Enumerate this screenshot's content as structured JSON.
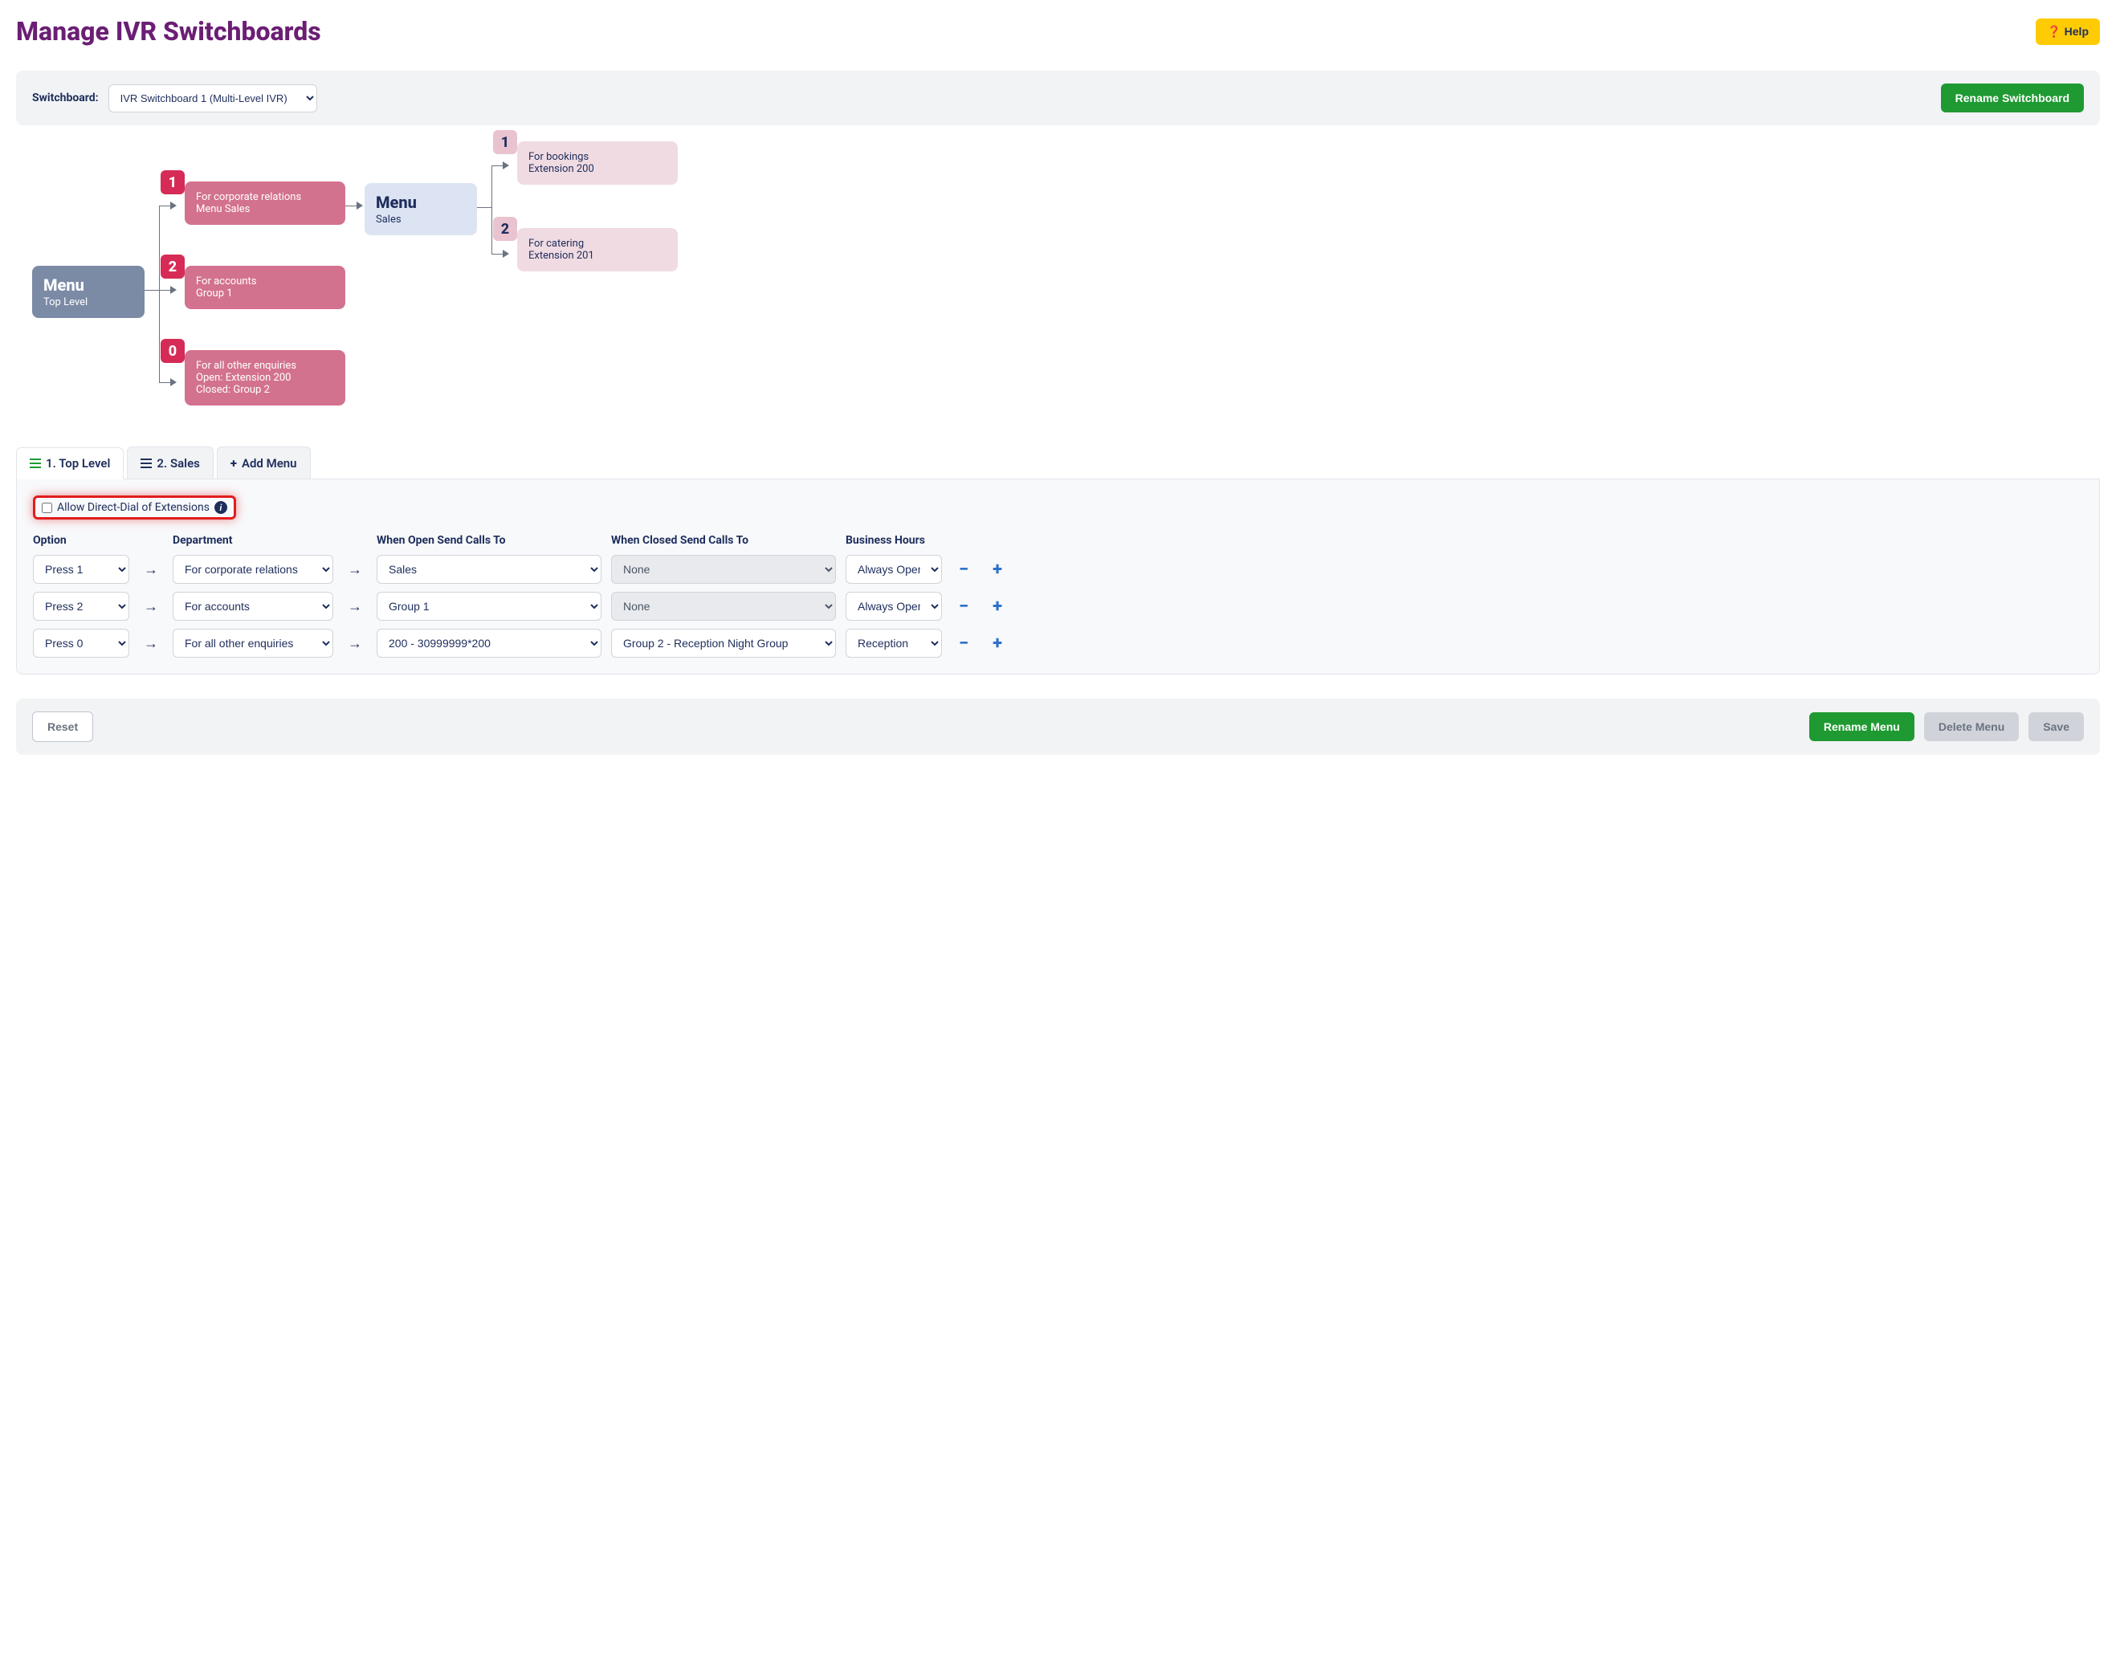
{
  "page_title": "Manage IVR Switchboards",
  "help_label": "Help",
  "toolbar": {
    "switchboard_label": "Switchboard:",
    "switchboard_value": "IVR Switchboard 1 (Multi-Level IVR)",
    "rename_label": "Rename Switchboard"
  },
  "diagram": {
    "root": {
      "title": "Menu",
      "sub": "Top Level"
    },
    "opts": [
      {
        "key": "1",
        "line1": "For corporate relations",
        "line2": "Menu Sales"
      },
      {
        "key": "2",
        "line1": "For accounts",
        "line2": "Group 1"
      },
      {
        "key": "0",
        "line1": "For all other enquiries",
        "line2": "Open: Extension 200",
        "line3": "Closed: Group 2"
      }
    ],
    "submenu": {
      "title": "Menu",
      "sub": "Sales"
    },
    "subopts": [
      {
        "key": "1",
        "line1": "For bookings",
        "line2": "Extension 200"
      },
      {
        "key": "2",
        "line1": "For catering",
        "line2": "Extension 201"
      }
    ]
  },
  "tabs": {
    "t1": "1. Top Level",
    "t2": "2. Sales",
    "add": "Add Menu"
  },
  "direct_dial_label": "Allow Direct-Dial of Extensions",
  "headers": {
    "option": "Option",
    "department": "Department",
    "open": "When Open Send Calls To",
    "closed": "When Closed Send Calls To",
    "hours": "Business Hours"
  },
  "rows": [
    {
      "option": "Press 1",
      "dept": "For corporate relations",
      "open": "Sales",
      "closed": "None",
      "closed_disabled": true,
      "hours": "Always Open"
    },
    {
      "option": "Press 2",
      "dept": "For accounts",
      "open": "Group 1",
      "closed": "None",
      "closed_disabled": true,
      "hours": "Always Open"
    },
    {
      "option": "Press 0",
      "dept": "For all other enquiries",
      "open": "200 - 30999999*200",
      "closed": "Group 2 - Reception Night Group",
      "closed_disabled": false,
      "hours": "Reception"
    }
  ],
  "footer": {
    "reset": "Reset",
    "rename_menu": "Rename Menu",
    "delete_menu": "Delete Menu",
    "save": "Save"
  }
}
